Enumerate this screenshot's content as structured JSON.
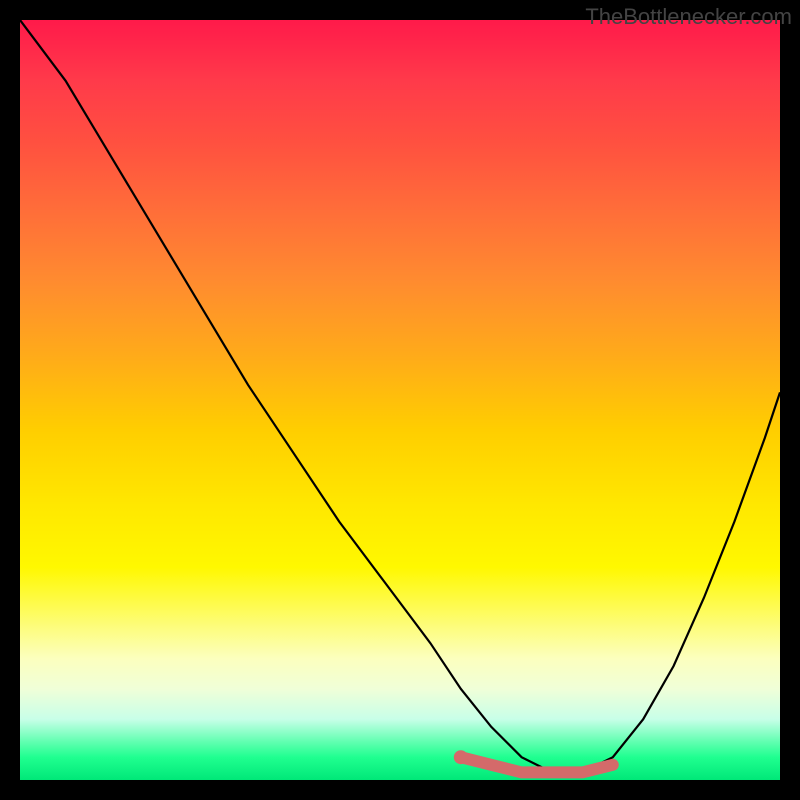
{
  "watermark": "TheBottlenecker.com",
  "chart_data": {
    "type": "line",
    "title": "",
    "xlabel": "",
    "ylabel": "",
    "xlim": [
      0,
      100
    ],
    "ylim": [
      0,
      100
    ],
    "series": [
      {
        "name": "curve",
        "x": [
          0,
          6,
          12,
          18,
          24,
          30,
          36,
          42,
          48,
          54,
          58,
          62,
          66,
          70,
          74,
          78,
          82,
          86,
          90,
          94,
          98,
          100
        ],
        "values": [
          100,
          92,
          82,
          72,
          62,
          52,
          43,
          34,
          26,
          18,
          12,
          7,
          3,
          1,
          1,
          3,
          8,
          15,
          24,
          34,
          45,
          51
        ]
      },
      {
        "name": "highlight",
        "x": [
          58,
          62,
          66,
          70,
          74,
          78
        ],
        "values": [
          3,
          2,
          1,
          1,
          1,
          2
        ]
      }
    ],
    "colors": {
      "curve": "#000000",
      "highlight": "#d46a6a",
      "gradient_top": "#ff1a4a",
      "gradient_bottom": "#00e878"
    }
  }
}
